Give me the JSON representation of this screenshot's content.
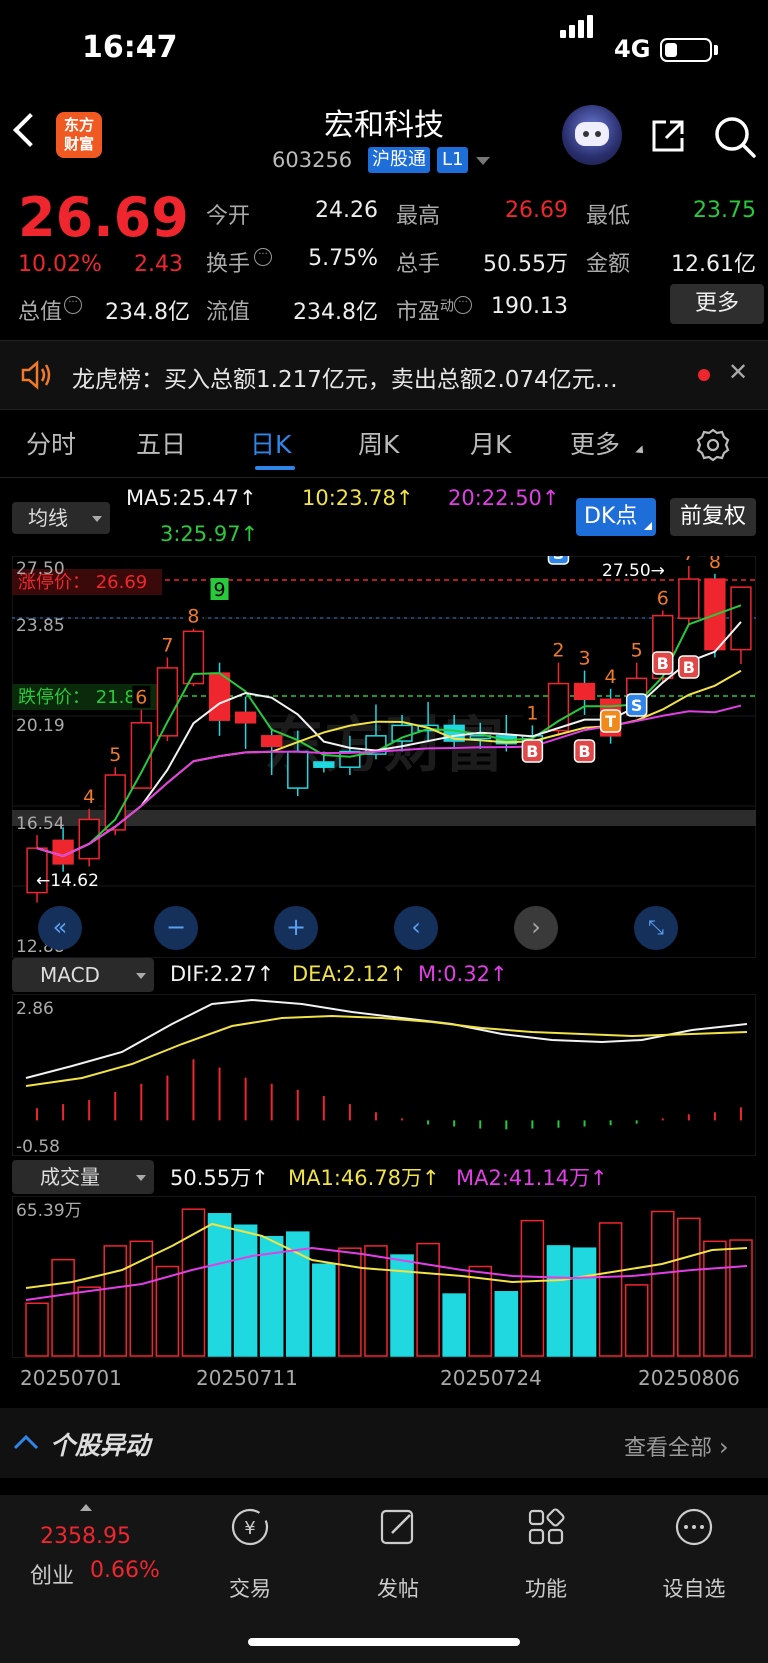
{
  "status": {
    "time": "16:47",
    "network": "4G"
  },
  "header": {
    "logo_line1": "东方",
    "logo_line2": "财富",
    "name": "宏和科技",
    "code": "603256",
    "market": "沪股通",
    "level": "L1"
  },
  "quote": {
    "price": "26.69",
    "pct": "10.02%",
    "change": "2.43",
    "open_label": "今开",
    "open": "24.26",
    "high_label": "最高",
    "high": "26.69",
    "low_label": "最低",
    "low": "23.75",
    "turnover_label": "换手",
    "turnover": "5.75%",
    "volume_label": "总手",
    "volume": "50.55万",
    "amount_label": "金额",
    "amount": "12.61亿",
    "mktcap_label": "总值",
    "mktcap": "234.8亿",
    "float_label": "流值",
    "float_cap": "234.8亿",
    "pe_label": "市盈",
    "pe_sup": "动",
    "pe": "190.13",
    "more": "更多"
  },
  "notice": {
    "text": "龙虎榜：买入总额1.217亿元，卖出总额2.074亿元…"
  },
  "tabs": [
    {
      "label": "分时"
    },
    {
      "label": "五日"
    },
    {
      "label": "日K"
    },
    {
      "label": "周K"
    },
    {
      "label": "月K"
    },
    {
      "label": "更多"
    }
  ],
  "ma": {
    "select": "均线",
    "ma5": "MA5:25.47↑",
    "ma10": "10:23.78↑",
    "ma20": "20:22.50↑",
    "ma3": "3:25.97↑",
    "dk": "DK点",
    "adjust": "前复权"
  },
  "kchart_labels": {
    "y_top": "27.50",
    "y_2": "23.85",
    "y_3": "20.19",
    "y_4": "16.54",
    "y_bottom": "12.88",
    "limit_up": "涨停价： 26.69",
    "limit_down": "跌停价： 21.83",
    "max_mark": "27.50→",
    "min_mark": "←14.62",
    "watermark": "东方财富"
  },
  "macd": {
    "select": "MACD",
    "dif": "DIF:2.27↑",
    "dea": "DEA:2.12↑",
    "m": "M:0.32↑",
    "y_top": "2.86",
    "y_bottom": "-0.58"
  },
  "volume": {
    "select": "成交量",
    "vol": "50.55万↑",
    "ma1": "MA1:46.78万↑",
    "ma2": "MA2:41.14万↑",
    "y_top": "65.39万"
  },
  "dates": [
    "20250701",
    "20250711",
    "20250724",
    "20250806"
  ],
  "movers": {
    "title": "个股异动",
    "all": "查看全部"
  },
  "bottom_nav": {
    "index_value": "2358.95",
    "index_name": "创业",
    "index_pct": "0.66%",
    "trade": "交易",
    "post": "发帖",
    "func": "功能",
    "watch": "设自选"
  },
  "chart_data": [
    {
      "type": "candlestick",
      "ylim": [
        12.88,
        27.5
      ],
      "candles": [
        {
          "o": 15.0,
          "c": 16.7,
          "h": 17.2,
          "l": 14.62,
          "up": true
        },
        {
          "o": 17.0,
          "c": 16.1,
          "h": 17.5,
          "l": 15.8,
          "up": false
        },
        {
          "o": 16.3,
          "c": 17.8,
          "h": 18.2,
          "l": 16.0,
          "up": true
        },
        {
          "o": 17.4,
          "c": 19.5,
          "h": 19.8,
          "l": 17.2,
          "up": true
        },
        {
          "o": 19.0,
          "c": 21.5,
          "h": 22.0,
          "l": 19.0,
          "up": true
        },
        {
          "o": 21.0,
          "c": 23.6,
          "h": 24.0,
          "l": 20.8,
          "up": true
        },
        {
          "o": 23.0,
          "c": 25.0,
          "h": 25.1,
          "l": 22.9,
          "up": true
        },
        {
          "o": 23.4,
          "c": 21.6,
          "h": 23.8,
          "l": 21.0,
          "up": false
        },
        {
          "o": 21.9,
          "c": 21.5,
          "h": 22.5,
          "l": 20.5,
          "up": false
        },
        {
          "o": 21.0,
          "c": 20.6,
          "h": 21.3,
          "l": 19.5,
          "up": false
        },
        {
          "o": 19.0,
          "c": 20.4,
          "h": 21.2,
          "l": 18.7,
          "up": true
        },
        {
          "o": 20.0,
          "c": 19.8,
          "h": 20.4,
          "l": 19.6,
          "up": true
        },
        {
          "o": 19.8,
          "c": 20.4,
          "h": 21.0,
          "l": 19.5,
          "up": true
        },
        {
          "o": 20.3,
          "c": 21.0,
          "h": 22.2,
          "l": 20.1,
          "up": true
        },
        {
          "o": 20.8,
          "c": 21.4,
          "h": 21.8,
          "l": 20.4,
          "up": true
        },
        {
          "o": 21.2,
          "c": 21.4,
          "h": 22.3,
          "l": 20.8,
          "up": true
        },
        {
          "o": 21.4,
          "c": 20.8,
          "h": 21.8,
          "l": 20.5,
          "up": true
        },
        {
          "o": 20.9,
          "c": 21.0,
          "h": 21.5,
          "l": 20.5,
          "up": true
        },
        {
          "o": 21.0,
          "c": 20.7,
          "h": 21.8,
          "l": 20.4,
          "up": true
        },
        {
          "o": 20.8,
          "c": 21.0,
          "h": 21.4,
          "l": 20.5,
          "up": false
        },
        {
          "o": 21.2,
          "c": 23.0,
          "h": 23.8,
          "l": 21.0,
          "up": true
        },
        {
          "o": 23.0,
          "c": 22.4,
          "h": 23.5,
          "l": 21.8,
          "up": false
        },
        {
          "o": 22.4,
          "c": 21.0,
          "h": 22.8,
          "l": 20.7,
          "up": false
        },
        {
          "o": 21.8,
          "c": 23.2,
          "h": 23.8,
          "l": 21.7,
          "up": true
        },
        {
          "o": 23.2,
          "c": 25.6,
          "h": 25.8,
          "l": 23.0,
          "up": true
        },
        {
          "o": 25.5,
          "c": 27.0,
          "h": 27.5,
          "l": 25.3,
          "up": true
        },
        {
          "o": 27.0,
          "c": 24.3,
          "h": 27.2,
          "l": 24.0,
          "up": false
        },
        {
          "o": 24.3,
          "c": 26.69,
          "h": 26.69,
          "l": 23.75,
          "up": true
        }
      ]
    },
    {
      "type": "bar",
      "series": [
        {
          "name": "M",
          "values": [
            0.3,
            0.4,
            0.5,
            0.7,
            0.9,
            1.1,
            1.5,
            1.3,
            1.05,
            0.9,
            0.75,
            0.6,
            0.4,
            0.2,
            0.05,
            -0.1,
            -0.15,
            -0.2,
            -0.22,
            -0.2,
            -0.18,
            -0.15,
            -0.12,
            -0.08,
            0.05,
            0.15,
            0.2,
            0.32
          ]
        }
      ],
      "ylim": [
        -0.58,
        2.86
      ]
    },
    {
      "type": "bar",
      "values": [
        23,
        42,
        30,
        48,
        50,
        39,
        64,
        62,
        57,
        52,
        54,
        40,
        47,
        48,
        44,
        49,
        27,
        39,
        28,
        59,
        48,
        47,
        58,
        31,
        63,
        60,
        50,
        50.55
      ],
      "ylim": [
        0,
        65.39
      ]
    }
  ]
}
